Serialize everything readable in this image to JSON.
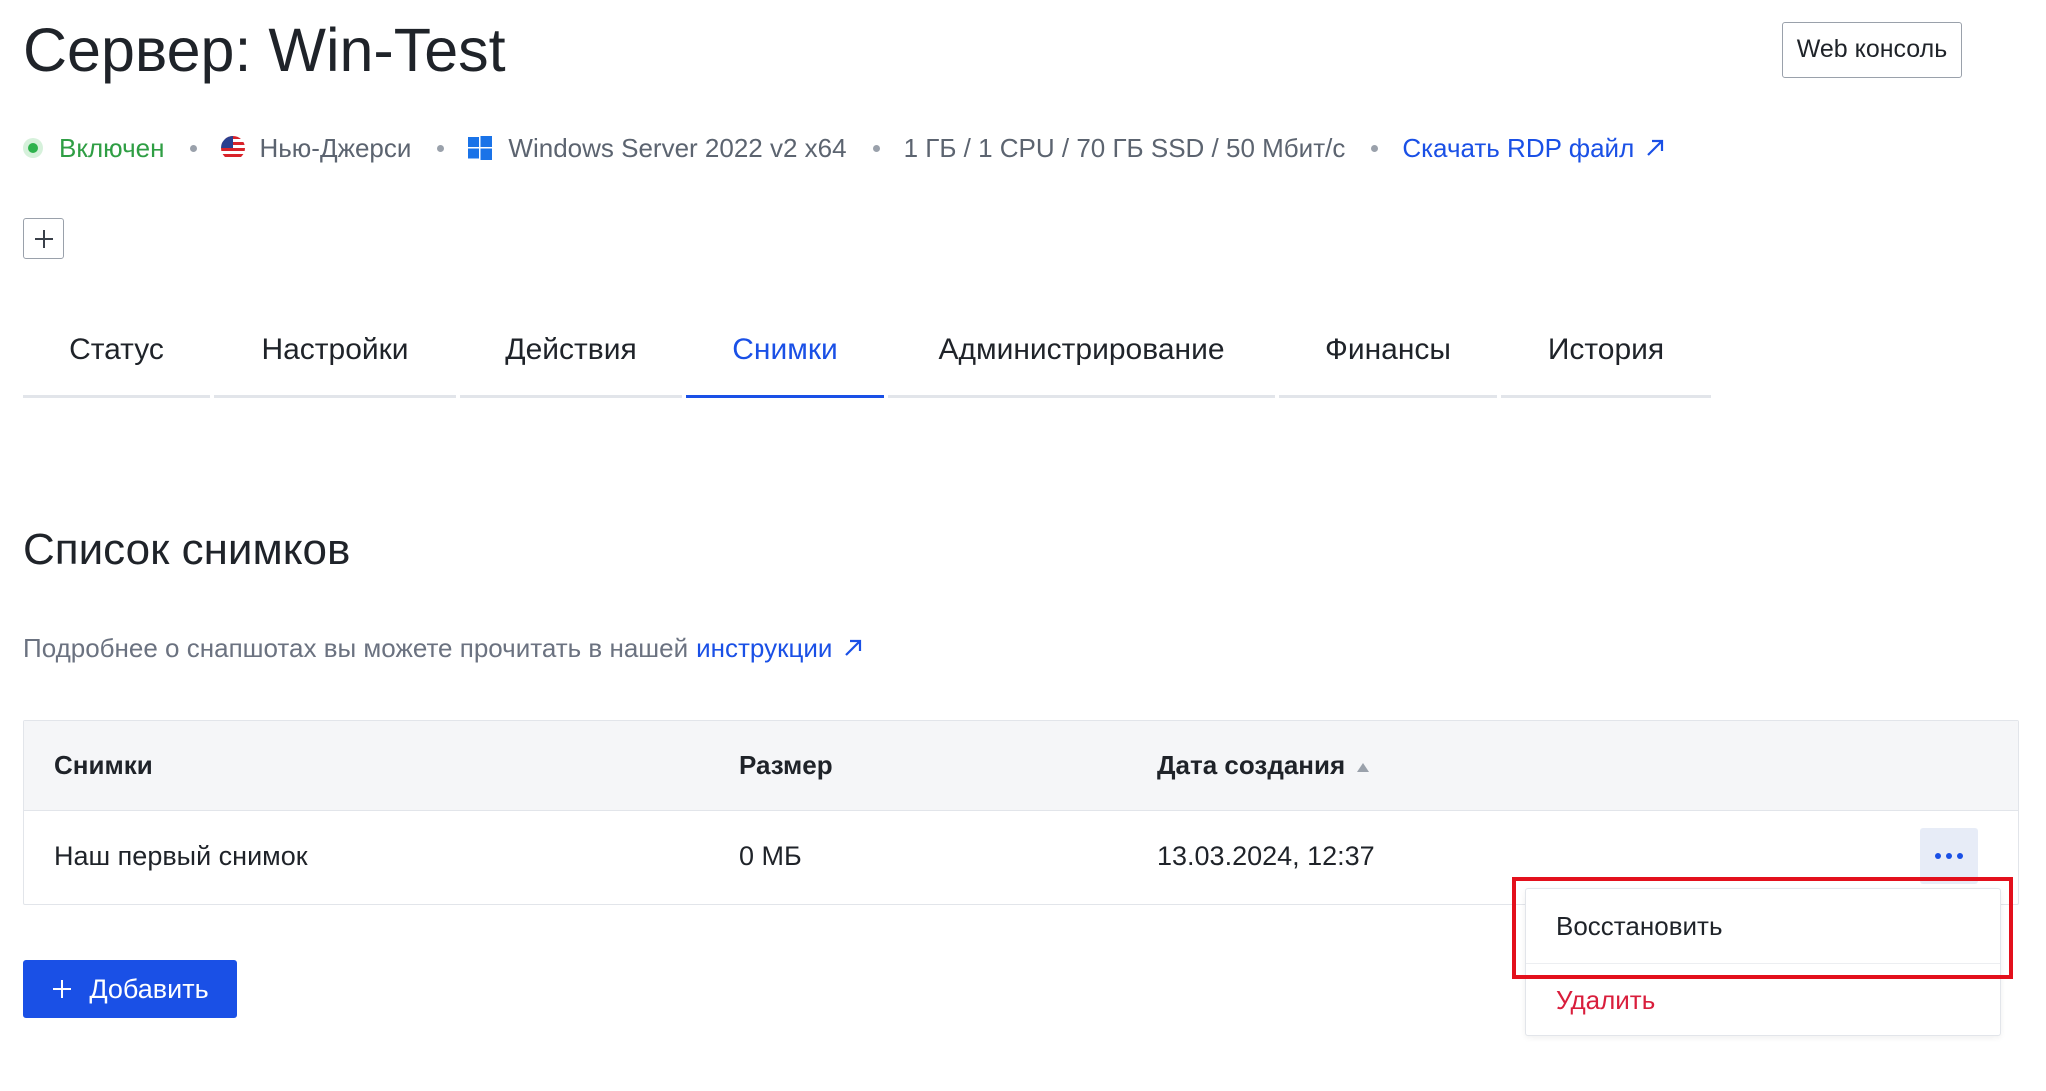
{
  "header": {
    "title": "Сервер: Win-Test",
    "web_console_label": "Web консоль"
  },
  "meta": {
    "status": "Включен",
    "location": "Нью-Джерси",
    "os": "Windows Server 2022 v2 x64",
    "resources": "1 ГБ / 1 CPU / 70 ГБ SSD / 50 Мбит/с",
    "rdp_link": "Скачать RDP файл"
  },
  "tabs": [
    {
      "label": "Статус",
      "active": false
    },
    {
      "label": "Настройки",
      "active": false
    },
    {
      "label": "Действия",
      "active": false
    },
    {
      "label": "Снимки",
      "active": true
    },
    {
      "label": "Администрирование",
      "active": false
    },
    {
      "label": "Финансы",
      "active": false
    },
    {
      "label": "История",
      "active": false
    }
  ],
  "snapshots": {
    "title": "Список снимков",
    "info_text": "Подробнее о снапшотах вы можете прочитать в нашей",
    "info_link": "инструкции",
    "columns": [
      "Снимки",
      "Размер",
      "Дата создания"
    ],
    "sort_column": "Дата создания",
    "rows": [
      {
        "name": "Наш первый снимок",
        "size": "0 МБ",
        "created": "13.03.2024, 12:37"
      }
    ],
    "add_button": "Добавить"
  },
  "row_menu": {
    "items": [
      "Восстановить",
      "Удалить"
    ]
  },
  "colors": {
    "accent": "#1a50e6",
    "status_green": "#2f9e44",
    "danger": "#d91e3c",
    "highlight": "#e3101c"
  }
}
